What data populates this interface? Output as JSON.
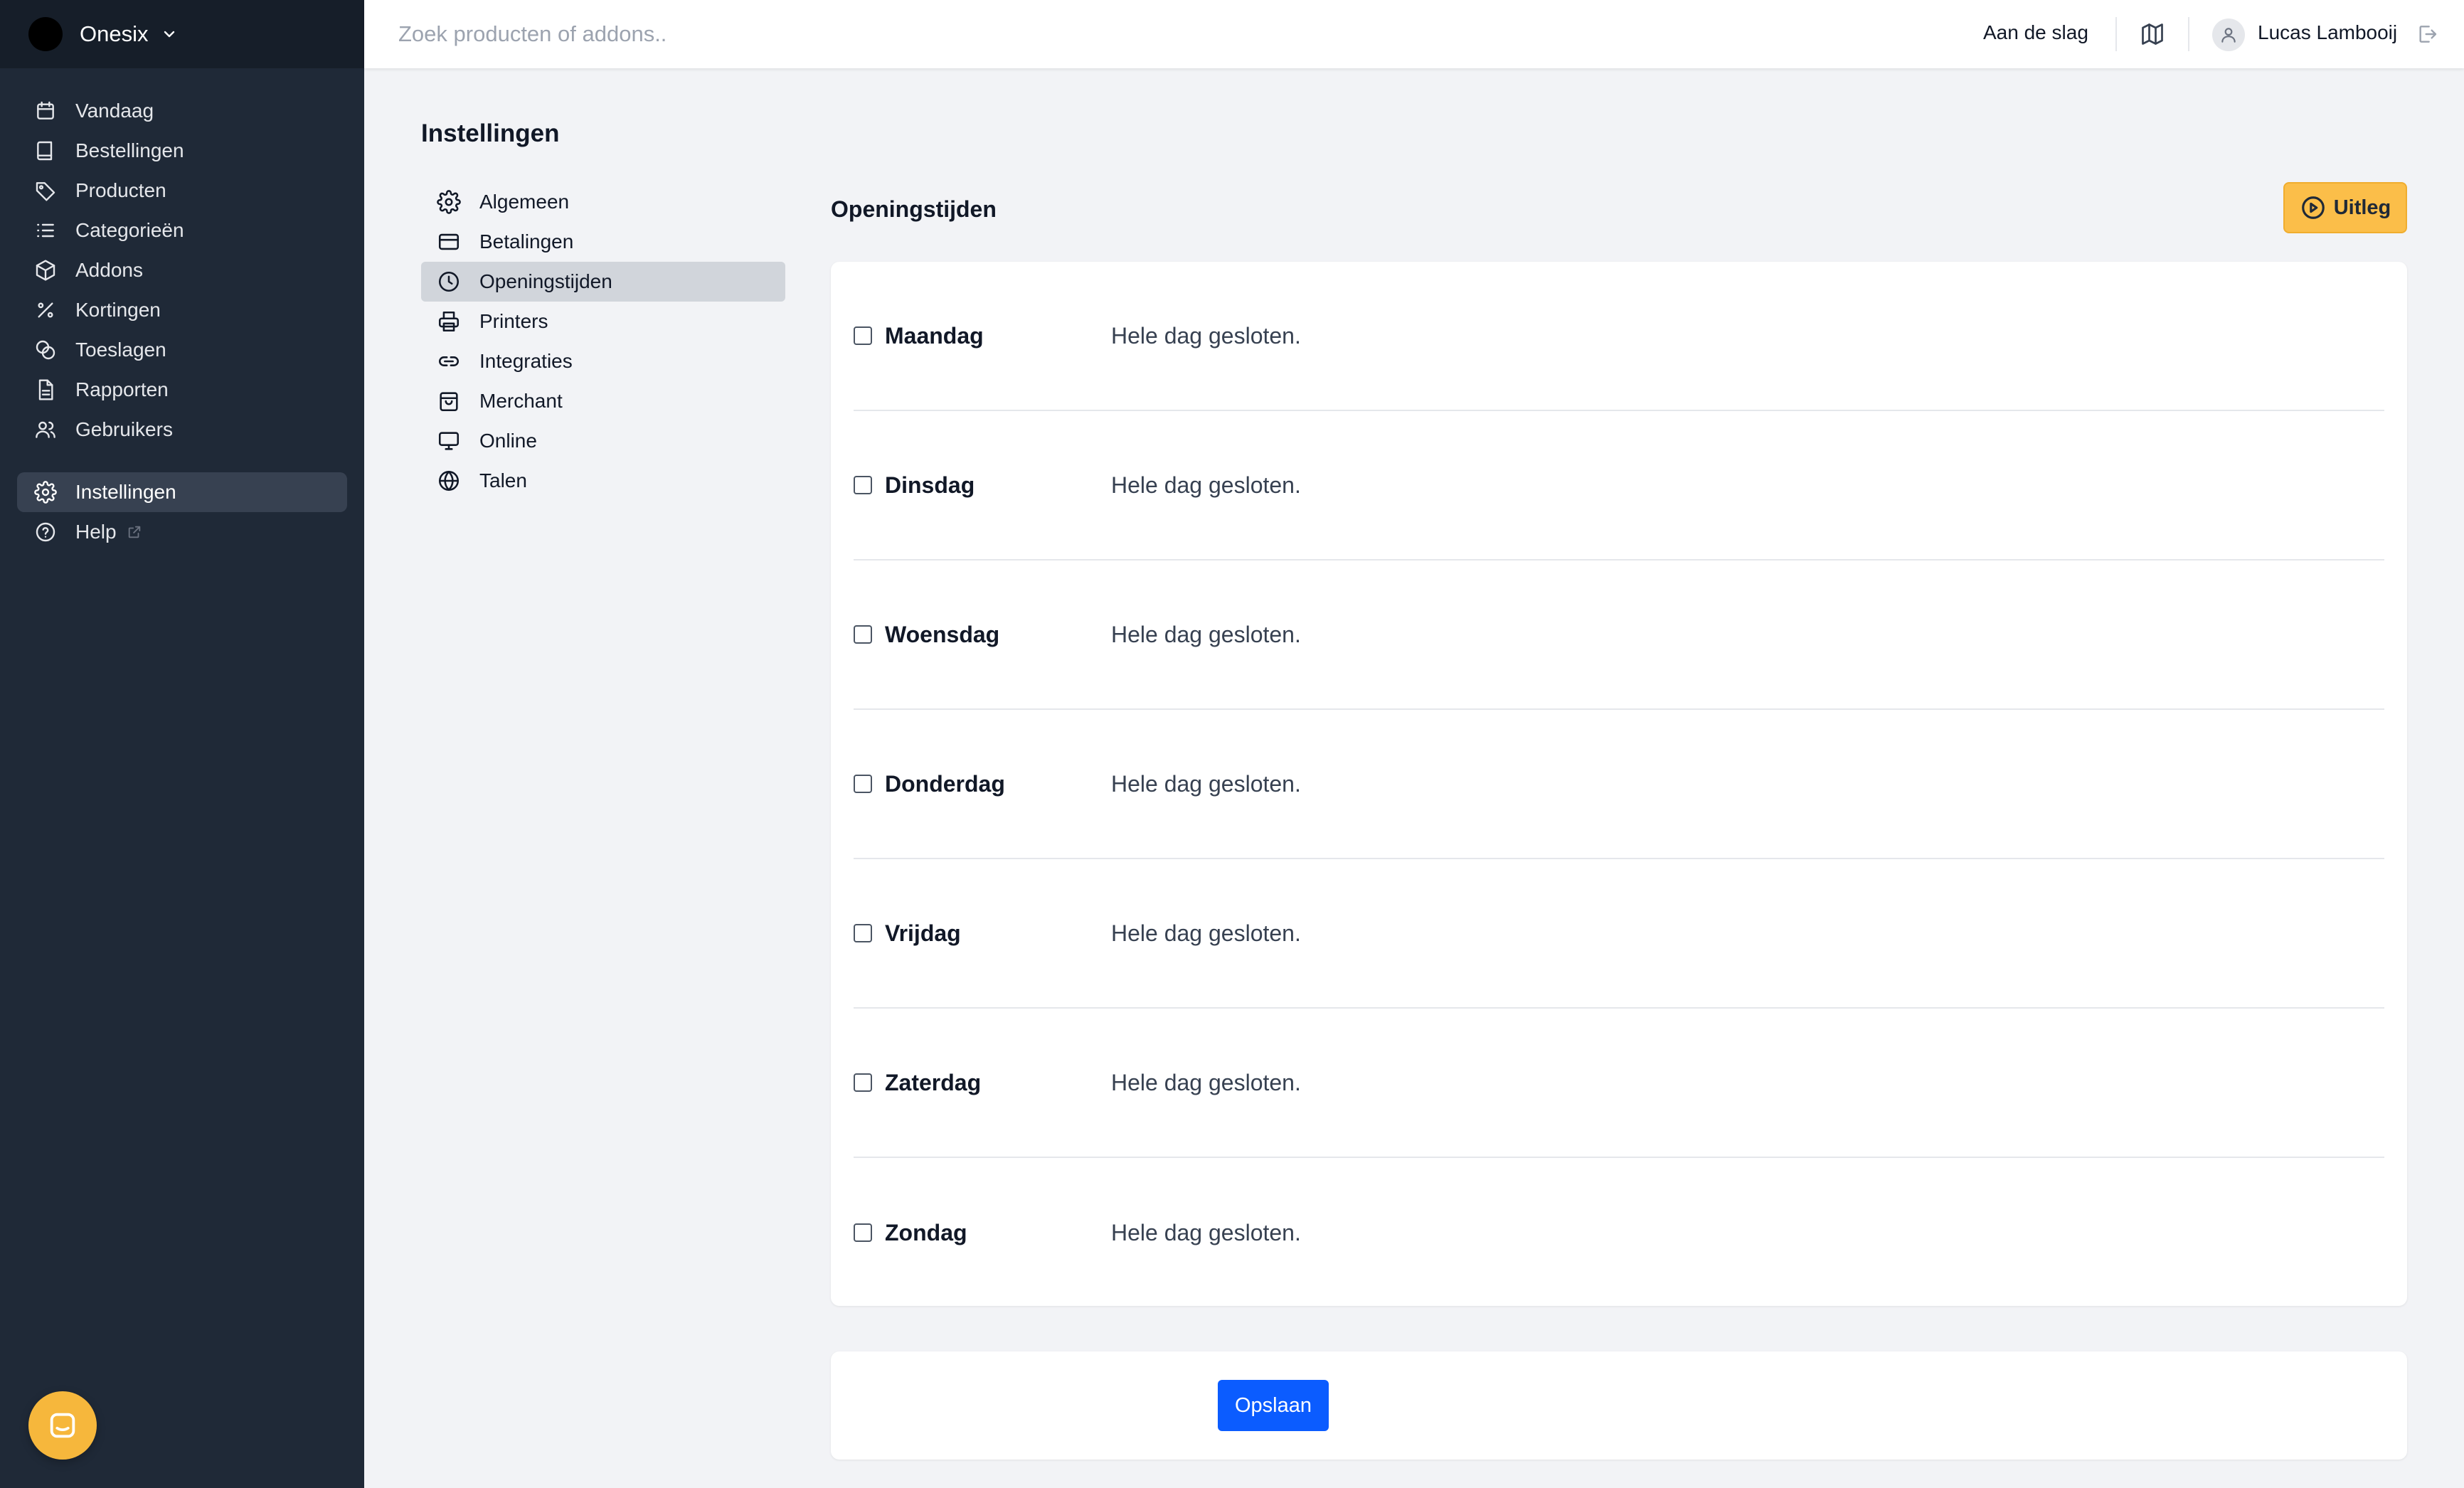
{
  "brand": {
    "name": "Onesix"
  },
  "sidebar": {
    "items": [
      {
        "label": "Vandaag",
        "icon": "calendar-icon"
      },
      {
        "label": "Bestellingen",
        "icon": "book-icon"
      },
      {
        "label": "Producten",
        "icon": "tag-icon"
      },
      {
        "label": "Categorieën",
        "icon": "list-icon"
      },
      {
        "label": "Addons",
        "icon": "cube-icon"
      },
      {
        "label": "Kortingen",
        "icon": "percent-icon"
      },
      {
        "label": "Toeslagen",
        "icon": "coins-icon"
      },
      {
        "label": "Rapporten",
        "icon": "document-icon"
      },
      {
        "label": "Gebruikers",
        "icon": "users-icon"
      }
    ],
    "bottom_items": [
      {
        "label": "Instellingen",
        "icon": "gear-icon",
        "active": true
      },
      {
        "label": "Help",
        "icon": "question-icon"
      }
    ]
  },
  "header": {
    "search_placeholder": "Zoek producten of addons..",
    "getting_started": "Aan de slag",
    "user_name": "Lucas Lambooij"
  },
  "settings": {
    "title": "Instellingen",
    "menu": [
      {
        "label": "Algemeen",
        "icon": "gear-icon"
      },
      {
        "label": "Betalingen",
        "icon": "credit-card-icon"
      },
      {
        "label": "Openingstijden",
        "icon": "clock-icon",
        "active": true
      },
      {
        "label": "Printers",
        "icon": "printer-icon"
      },
      {
        "label": "Integraties",
        "icon": "link-icon"
      },
      {
        "label": "Merchant",
        "icon": "shopping-bag-icon"
      },
      {
        "label": "Online",
        "icon": "monitor-icon"
      },
      {
        "label": "Talen",
        "icon": "globe-icon"
      }
    ]
  },
  "opening_hours": {
    "title": "Openingstijden",
    "explain_label": "Uitleg",
    "days": [
      {
        "name": "Maandag",
        "status": "Hele dag gesloten.",
        "checked": false
      },
      {
        "name": "Dinsdag",
        "status": "Hele dag gesloten.",
        "checked": false
      },
      {
        "name": "Woensdag",
        "status": "Hele dag gesloten.",
        "checked": false
      },
      {
        "name": "Donderdag",
        "status": "Hele dag gesloten.",
        "checked": false
      },
      {
        "name": "Vrijdag",
        "status": "Hele dag gesloten.",
        "checked": false
      },
      {
        "name": "Zaterdag",
        "status": "Hele dag gesloten.",
        "checked": false
      },
      {
        "name": "Zondag",
        "status": "Hele dag gesloten.",
        "checked": false
      }
    ],
    "save_label": "Opslaan"
  },
  "colors": {
    "sidebar_bg": "#1f2937",
    "accent_yellow": "#fbbe49",
    "primary_blue": "#0b5cff"
  }
}
